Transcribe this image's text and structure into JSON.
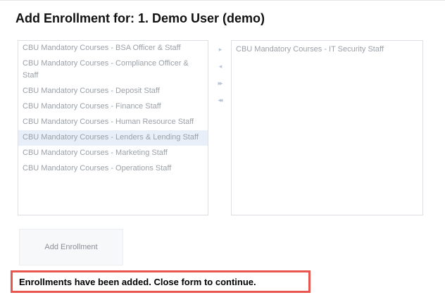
{
  "form": {
    "title": "Add Enrollment for: 1. Demo User (demo)"
  },
  "available_courses": [
    {
      "label": "CBU Mandatory Courses - BSA Officer & Staff",
      "selected": false
    },
    {
      "label": "CBU Mandatory Courses - Compliance Officer & Staff",
      "selected": false
    },
    {
      "label": "CBU Mandatory Courses - Deposit Staff",
      "selected": false
    },
    {
      "label": "CBU Mandatory Courses - Finance Staff",
      "selected": false
    },
    {
      "label": "CBU Mandatory Courses - Human Resource Staff",
      "selected": false
    },
    {
      "label": "CBU Mandatory Courses - Lenders & Lending Staff",
      "selected": true
    },
    {
      "label": "CBU Mandatory Courses - Marketing Staff",
      "selected": false
    },
    {
      "label": "CBU Mandatory Courses - Operations Staff",
      "selected": false
    }
  ],
  "enrolled_courses": [
    {
      "label": "CBU Mandatory Courses - IT Security Staff",
      "selected": false
    }
  ],
  "move_buttons": [
    {
      "name": "move-right-button",
      "icon": "chevron-right-icon",
      "glyph": "▸"
    },
    {
      "name": "move-left-button",
      "icon": "chevron-left-icon",
      "glyph": "◂"
    },
    {
      "name": "move-all-right-button",
      "icon": "double-chevron-right-icon",
      "glyph": "▸▸"
    },
    {
      "name": "move-all-left-button",
      "icon": "double-chevron-left-icon",
      "glyph": "◂◂"
    }
  ],
  "actions": {
    "add_label": "Add Enrollment"
  },
  "status": {
    "message": "Enrollments have been added. Close form to continue.",
    "highlight_color": "#e7574f"
  }
}
